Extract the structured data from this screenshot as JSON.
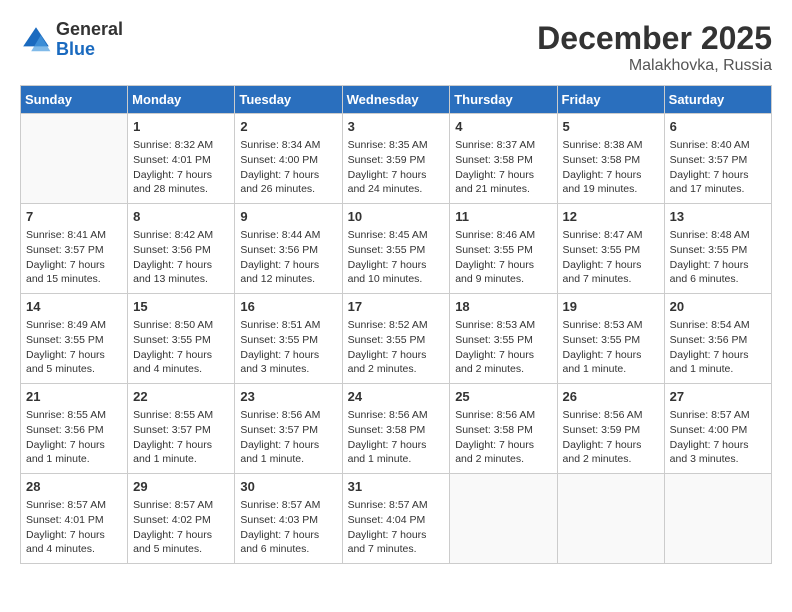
{
  "header": {
    "logo_general": "General",
    "logo_blue": "Blue",
    "month_title": "December 2025",
    "location": "Malakhovka, Russia"
  },
  "weekdays": [
    "Sunday",
    "Monday",
    "Tuesday",
    "Wednesday",
    "Thursday",
    "Friday",
    "Saturday"
  ],
  "weeks": [
    [
      {
        "day": "",
        "info": ""
      },
      {
        "day": "1",
        "info": "Sunrise: 8:32 AM\nSunset: 4:01 PM\nDaylight: 7 hours\nand 28 minutes."
      },
      {
        "day": "2",
        "info": "Sunrise: 8:34 AM\nSunset: 4:00 PM\nDaylight: 7 hours\nand 26 minutes."
      },
      {
        "day": "3",
        "info": "Sunrise: 8:35 AM\nSunset: 3:59 PM\nDaylight: 7 hours\nand 24 minutes."
      },
      {
        "day": "4",
        "info": "Sunrise: 8:37 AM\nSunset: 3:58 PM\nDaylight: 7 hours\nand 21 minutes."
      },
      {
        "day": "5",
        "info": "Sunrise: 8:38 AM\nSunset: 3:58 PM\nDaylight: 7 hours\nand 19 minutes."
      },
      {
        "day": "6",
        "info": "Sunrise: 8:40 AM\nSunset: 3:57 PM\nDaylight: 7 hours\nand 17 minutes."
      }
    ],
    [
      {
        "day": "7",
        "info": "Sunrise: 8:41 AM\nSunset: 3:57 PM\nDaylight: 7 hours\nand 15 minutes."
      },
      {
        "day": "8",
        "info": "Sunrise: 8:42 AM\nSunset: 3:56 PM\nDaylight: 7 hours\nand 13 minutes."
      },
      {
        "day": "9",
        "info": "Sunrise: 8:44 AM\nSunset: 3:56 PM\nDaylight: 7 hours\nand 12 minutes."
      },
      {
        "day": "10",
        "info": "Sunrise: 8:45 AM\nSunset: 3:55 PM\nDaylight: 7 hours\nand 10 minutes."
      },
      {
        "day": "11",
        "info": "Sunrise: 8:46 AM\nSunset: 3:55 PM\nDaylight: 7 hours\nand 9 minutes."
      },
      {
        "day": "12",
        "info": "Sunrise: 8:47 AM\nSunset: 3:55 PM\nDaylight: 7 hours\nand 7 minutes."
      },
      {
        "day": "13",
        "info": "Sunrise: 8:48 AM\nSunset: 3:55 PM\nDaylight: 7 hours\nand 6 minutes."
      }
    ],
    [
      {
        "day": "14",
        "info": "Sunrise: 8:49 AM\nSunset: 3:55 PM\nDaylight: 7 hours\nand 5 minutes."
      },
      {
        "day": "15",
        "info": "Sunrise: 8:50 AM\nSunset: 3:55 PM\nDaylight: 7 hours\nand 4 minutes."
      },
      {
        "day": "16",
        "info": "Sunrise: 8:51 AM\nSunset: 3:55 PM\nDaylight: 7 hours\nand 3 minutes."
      },
      {
        "day": "17",
        "info": "Sunrise: 8:52 AM\nSunset: 3:55 PM\nDaylight: 7 hours\nand 2 minutes."
      },
      {
        "day": "18",
        "info": "Sunrise: 8:53 AM\nSunset: 3:55 PM\nDaylight: 7 hours\nand 2 minutes."
      },
      {
        "day": "19",
        "info": "Sunrise: 8:53 AM\nSunset: 3:55 PM\nDaylight: 7 hours\nand 1 minute."
      },
      {
        "day": "20",
        "info": "Sunrise: 8:54 AM\nSunset: 3:56 PM\nDaylight: 7 hours\nand 1 minute."
      }
    ],
    [
      {
        "day": "21",
        "info": "Sunrise: 8:55 AM\nSunset: 3:56 PM\nDaylight: 7 hours\nand 1 minute."
      },
      {
        "day": "22",
        "info": "Sunrise: 8:55 AM\nSunset: 3:57 PM\nDaylight: 7 hours\nand 1 minute."
      },
      {
        "day": "23",
        "info": "Sunrise: 8:56 AM\nSunset: 3:57 PM\nDaylight: 7 hours\nand 1 minute."
      },
      {
        "day": "24",
        "info": "Sunrise: 8:56 AM\nSunset: 3:58 PM\nDaylight: 7 hours\nand 1 minute."
      },
      {
        "day": "25",
        "info": "Sunrise: 8:56 AM\nSunset: 3:58 PM\nDaylight: 7 hours\nand 2 minutes."
      },
      {
        "day": "26",
        "info": "Sunrise: 8:56 AM\nSunset: 3:59 PM\nDaylight: 7 hours\nand 2 minutes."
      },
      {
        "day": "27",
        "info": "Sunrise: 8:57 AM\nSunset: 4:00 PM\nDaylight: 7 hours\nand 3 minutes."
      }
    ],
    [
      {
        "day": "28",
        "info": "Sunrise: 8:57 AM\nSunset: 4:01 PM\nDaylight: 7 hours\nand 4 minutes."
      },
      {
        "day": "29",
        "info": "Sunrise: 8:57 AM\nSunset: 4:02 PM\nDaylight: 7 hours\nand 5 minutes."
      },
      {
        "day": "30",
        "info": "Sunrise: 8:57 AM\nSunset: 4:03 PM\nDaylight: 7 hours\nand 6 minutes."
      },
      {
        "day": "31",
        "info": "Sunrise: 8:57 AM\nSunset: 4:04 PM\nDaylight: 7 hours\nand 7 minutes."
      },
      {
        "day": "",
        "info": ""
      },
      {
        "day": "",
        "info": ""
      },
      {
        "day": "",
        "info": ""
      }
    ]
  ]
}
